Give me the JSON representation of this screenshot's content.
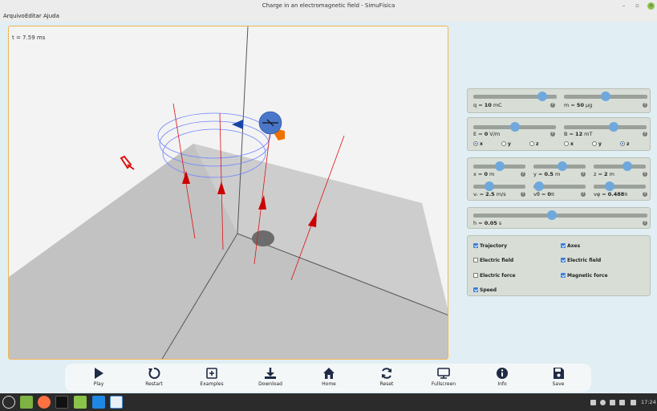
{
  "window": {
    "title": "Charge in an electromagnetic field - SimuFísica",
    "minimize_glyph": "–",
    "maximize_glyph": "▫",
    "close_glyph": "×"
  },
  "menu": {
    "items": [
      "Arquivo",
      "Editar",
      "Ajuda"
    ]
  },
  "simulation": {
    "time_label": "t = 7.59 ms"
  },
  "panels": {
    "charge_mass": {
      "q_prefix": "q = ",
      "q_value": "10",
      "q_unit": " mC",
      "q_level": 0.83,
      "m_prefix": "m = ",
      "m_value": "50",
      "m_unit": " µg",
      "m_level": 0.5
    },
    "fields": {
      "E_prefix": "E = ",
      "E_value": "0",
      "E_unit": " V/m",
      "E_level": 0.5,
      "B_prefix": "B = ",
      "B_value": "12",
      "B_unit": " mT",
      "B_level": 0.6,
      "e_axes": [
        "x",
        "y",
        "z"
      ],
      "e_selected": "x",
      "b_axes": [
        "x",
        "y",
        "z"
      ],
      "b_selected": "z"
    },
    "initial": {
      "x_prefix": "x = ",
      "x_value": "0",
      "x_unit": " m",
      "x_level": 0.5,
      "y_prefix": "y = ",
      "y_value": "0.5",
      "y_unit": " m",
      "y_level": 0.55,
      "z_prefix": "z = ",
      "z_value": "2",
      "z_unit": " m",
      "z_level": 0.65,
      "vr_prefix": "vᵣ = ",
      "vr_value": "2.5",
      "vr_unit": " m/s",
      "vr_level": 0.3,
      "vtheta_prefix": "vθ = ",
      "vtheta_value": "0",
      "vtheta_unit": "π",
      "vtheta_level": 0.1,
      "vphi_prefix": "vφ = ",
      "vphi_value": "0.488",
      "vphi_unit": "π",
      "vphi_level": 0.3
    },
    "step": {
      "h_prefix": "h = ",
      "h_value": "0.05",
      "h_unit": " s",
      "h_level": 0.45
    },
    "display": {
      "checkboxes": [
        {
          "label": "Trajectory",
          "checked": true
        },
        {
          "label": "Axes",
          "checked": true
        },
        {
          "label": "Electric field",
          "checked": false
        },
        {
          "label": "Electric field",
          "checked": true
        },
        {
          "label": "Electric force",
          "checked": false
        },
        {
          "label": "Magnetic force",
          "checked": true
        },
        {
          "label": "Speed",
          "checked": true
        }
      ]
    },
    "help_glyph": "?"
  },
  "toolbar": {
    "buttons": [
      "Play",
      "Restart",
      "Examples",
      "Download",
      "Home",
      "Reset",
      "Fullscreen",
      "Info",
      "Save"
    ]
  },
  "taskbar": {
    "clock": "17:24"
  },
  "colors": {
    "accent": "#6fa8dc",
    "viewport_border": "#f2b450",
    "field_lines": "#d11",
    "trajectory": "#6f83ff",
    "icon_dark": "#1f2a44"
  }
}
